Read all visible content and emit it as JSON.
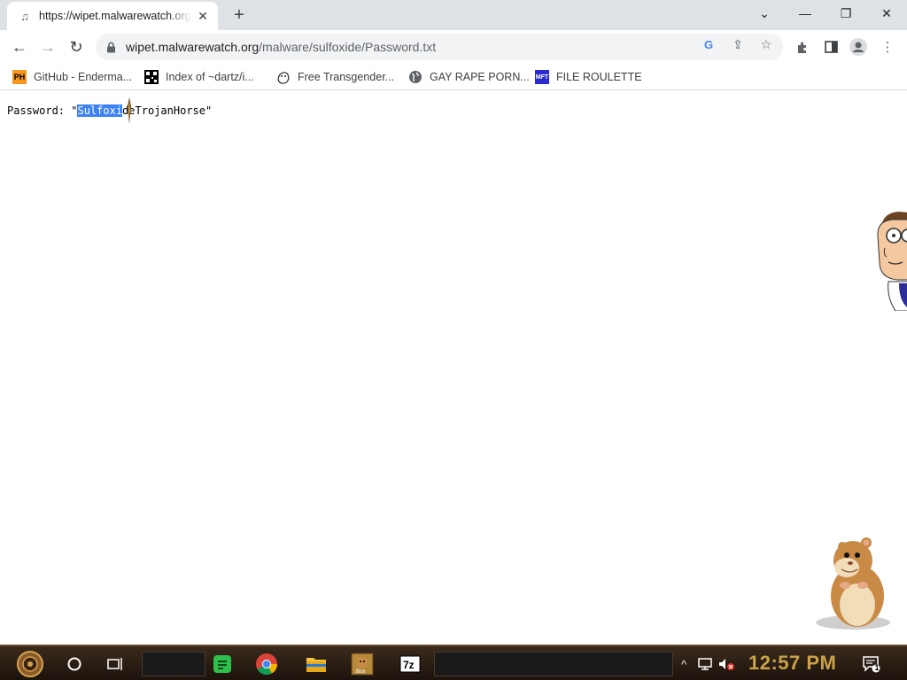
{
  "browser": {
    "tab": {
      "title": "https://wipet.malwarewatch.org",
      "favicon": "music-note-icon"
    },
    "url": {
      "host": "wipet.malwarewatch.org",
      "path": "/malware/sulfoxide/Password.txt"
    },
    "bookmarks": [
      {
        "label": "GitHub - Enderma...",
        "icon": "PH",
        "icon_bg": "#f7971d",
        "icon_fg": "#000"
      },
      {
        "label": "Index of ~dartz/i...",
        "icon": "qr",
        "icon_bg": "#000",
        "icon_fg": "#fff"
      },
      {
        "label": "Free Transgender...",
        "icon": "blob",
        "icon_bg": "#fff",
        "icon_fg": "#333"
      },
      {
        "label": "GAY RAPE PORN...",
        "icon": "globe",
        "icon_bg": "#fff",
        "icon_fg": "#5f6368"
      },
      {
        "label": "FILE ROULETTE",
        "icon": "MFT",
        "icon_bg": "#2a2ad0",
        "icon_fg": "#fff"
      }
    ]
  },
  "page": {
    "prefix": "Password: \"",
    "selected": "Sulfoxi",
    "rest": "de",
    "suffix": "TrojanHorse\""
  },
  "taskbar": {
    "clock": "12:57 PM",
    "notification_count": "1"
  },
  "colors": {
    "selection": "#3b82f6",
    "clock": "#c9a24a"
  }
}
